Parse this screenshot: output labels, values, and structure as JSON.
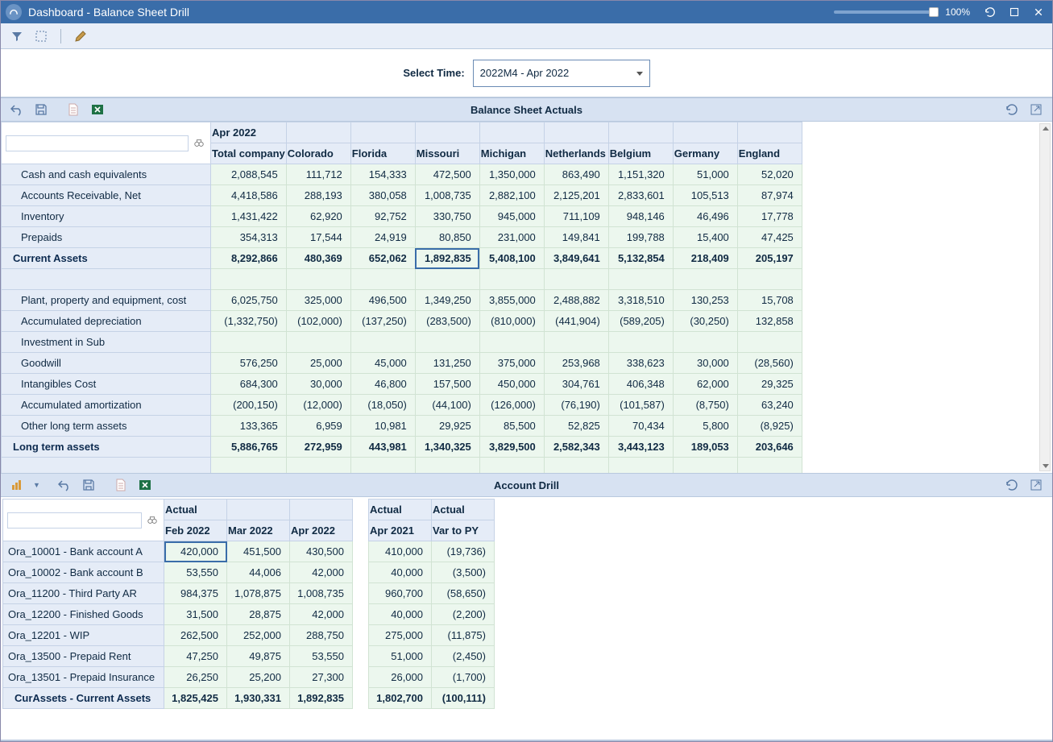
{
  "window": {
    "title": "Dashboard - Balance Sheet Drill",
    "zoom": "100%"
  },
  "select_time": {
    "label": "Select Time:",
    "value": "2022M4 - Apr 2022"
  },
  "panel1": {
    "title": "Balance Sheet Actuals",
    "period": "Apr 2022",
    "columns": [
      "Total company",
      "Colorado",
      "Florida",
      "Missouri",
      "Michigan",
      "Netherlands",
      "Belgium",
      "Germany",
      "England"
    ],
    "rows": [
      {
        "label": "Cash and cash equivalents",
        "bold": false,
        "vals": [
          "2,088,545",
          "111,712",
          "154,333",
          "472,500",
          "1,350,000",
          "863,490",
          "1,151,320",
          "51,000",
          "52,020"
        ]
      },
      {
        "label": "Accounts Receivable, Net",
        "bold": false,
        "vals": [
          "4,418,586",
          "288,193",
          "380,058",
          "1,008,735",
          "2,882,100",
          "2,125,201",
          "2,833,601",
          "105,513",
          "87,974"
        ]
      },
      {
        "label": "Inventory",
        "bold": false,
        "vals": [
          "1,431,422",
          "62,920",
          "92,752",
          "330,750",
          "945,000",
          "711,109",
          "948,146",
          "46,496",
          "17,778"
        ]
      },
      {
        "label": "Prepaids",
        "bold": false,
        "vals": [
          "354,313",
          "17,544",
          "24,919",
          "80,850",
          "231,000",
          "149,841",
          "199,788",
          "15,400",
          "47,425"
        ]
      },
      {
        "label": "Current Assets",
        "bold": true,
        "vals": [
          "8,292,866",
          "480,369",
          "652,062",
          "1,892,835",
          "5,408,100",
          "3,849,641",
          "5,132,854",
          "218,409",
          "205,197"
        ],
        "selected_col": 3
      },
      {
        "blank": true
      },
      {
        "label": "Plant, property and equipment, cost",
        "bold": false,
        "vals": [
          "6,025,750",
          "325,000",
          "496,500",
          "1,349,250",
          "3,855,000",
          "2,488,882",
          "3,318,510",
          "130,253",
          "15,708"
        ]
      },
      {
        "label": "Accumulated depreciation",
        "bold": false,
        "vals": [
          "(1,332,750)",
          "(102,000)",
          "(137,250)",
          "(283,500)",
          "(810,000)",
          "(441,904)",
          "(589,205)",
          "(30,250)",
          "132,858"
        ]
      },
      {
        "label": "Investment in Sub",
        "bold": false,
        "vals": [
          "",
          "",
          "",
          "",
          "",
          "",
          "",
          "",
          ""
        ]
      },
      {
        "label": "Goodwill",
        "bold": false,
        "vals": [
          "576,250",
          "25,000",
          "45,000",
          "131,250",
          "375,000",
          "253,968",
          "338,623",
          "30,000",
          "(28,560)"
        ]
      },
      {
        "label": "Intangibles Cost",
        "bold": false,
        "vals": [
          "684,300",
          "30,000",
          "46,800",
          "157,500",
          "450,000",
          "304,761",
          "406,348",
          "62,000",
          "29,325"
        ]
      },
      {
        "label": "Accumulated amortization",
        "bold": false,
        "vals": [
          "(200,150)",
          "(12,000)",
          "(18,050)",
          "(44,100)",
          "(126,000)",
          "(76,190)",
          "(101,587)",
          "(8,750)",
          "63,240"
        ]
      },
      {
        "label": "Other long term assets",
        "bold": false,
        "vals": [
          "133,365",
          "6,959",
          "10,981",
          "29,925",
          "85,500",
          "52,825",
          "70,434",
          "5,800",
          "(8,925)"
        ]
      },
      {
        "label": "Long term assets",
        "bold": true,
        "vals": [
          "5,886,765",
          "272,959",
          "443,981",
          "1,340,325",
          "3,829,500",
          "2,582,343",
          "3,443,123",
          "189,053",
          "203,646"
        ]
      },
      {
        "blank": true
      }
    ]
  },
  "panel2": {
    "title": "Account Drill",
    "col_groups": [
      {
        "super": "Actual",
        "cols": [
          "Feb 2022",
          "Mar 2022",
          "Apr 2022"
        ]
      },
      {
        "super": "Actual",
        "cols": [
          "Apr 2021"
        ]
      },
      {
        "super": "Actual",
        "cols": [
          "Var to PY"
        ]
      }
    ],
    "rows": [
      {
        "label": "Ora_10001 - Bank account A",
        "vals": [
          "420,000",
          "451,500",
          "430,500",
          "410,000",
          "(19,736)"
        ],
        "selected_col": 0
      },
      {
        "label": "Ora_10002 - Bank account B",
        "vals": [
          "53,550",
          "44,006",
          "42,000",
          "40,000",
          "(3,500)"
        ]
      },
      {
        "label": "Ora_11200 - Third Party AR",
        "vals": [
          "984,375",
          "1,078,875",
          "1,008,735",
          "960,700",
          "(58,650)"
        ]
      },
      {
        "label": "Ora_12200 - Finished Goods",
        "vals": [
          "31,500",
          "28,875",
          "42,000",
          "40,000",
          "(2,200)"
        ]
      },
      {
        "label": "Ora_12201 - WIP",
        "vals": [
          "262,500",
          "252,000",
          "288,750",
          "275,000",
          "(11,875)"
        ]
      },
      {
        "label": "Ora_13500 - Prepaid Rent",
        "vals": [
          "47,250",
          "49,875",
          "53,550",
          "51,000",
          "(2,450)"
        ]
      },
      {
        "label": "Ora_13501 - Prepaid Insurance",
        "vals": [
          "26,250",
          "25,200",
          "27,300",
          "26,000",
          "(1,700)"
        ]
      },
      {
        "label": "CurAssets - Current Assets",
        "bold": true,
        "vals": [
          "1,825,425",
          "1,930,331",
          "1,892,835",
          "1,802,700",
          "(100,111)"
        ]
      }
    ]
  }
}
